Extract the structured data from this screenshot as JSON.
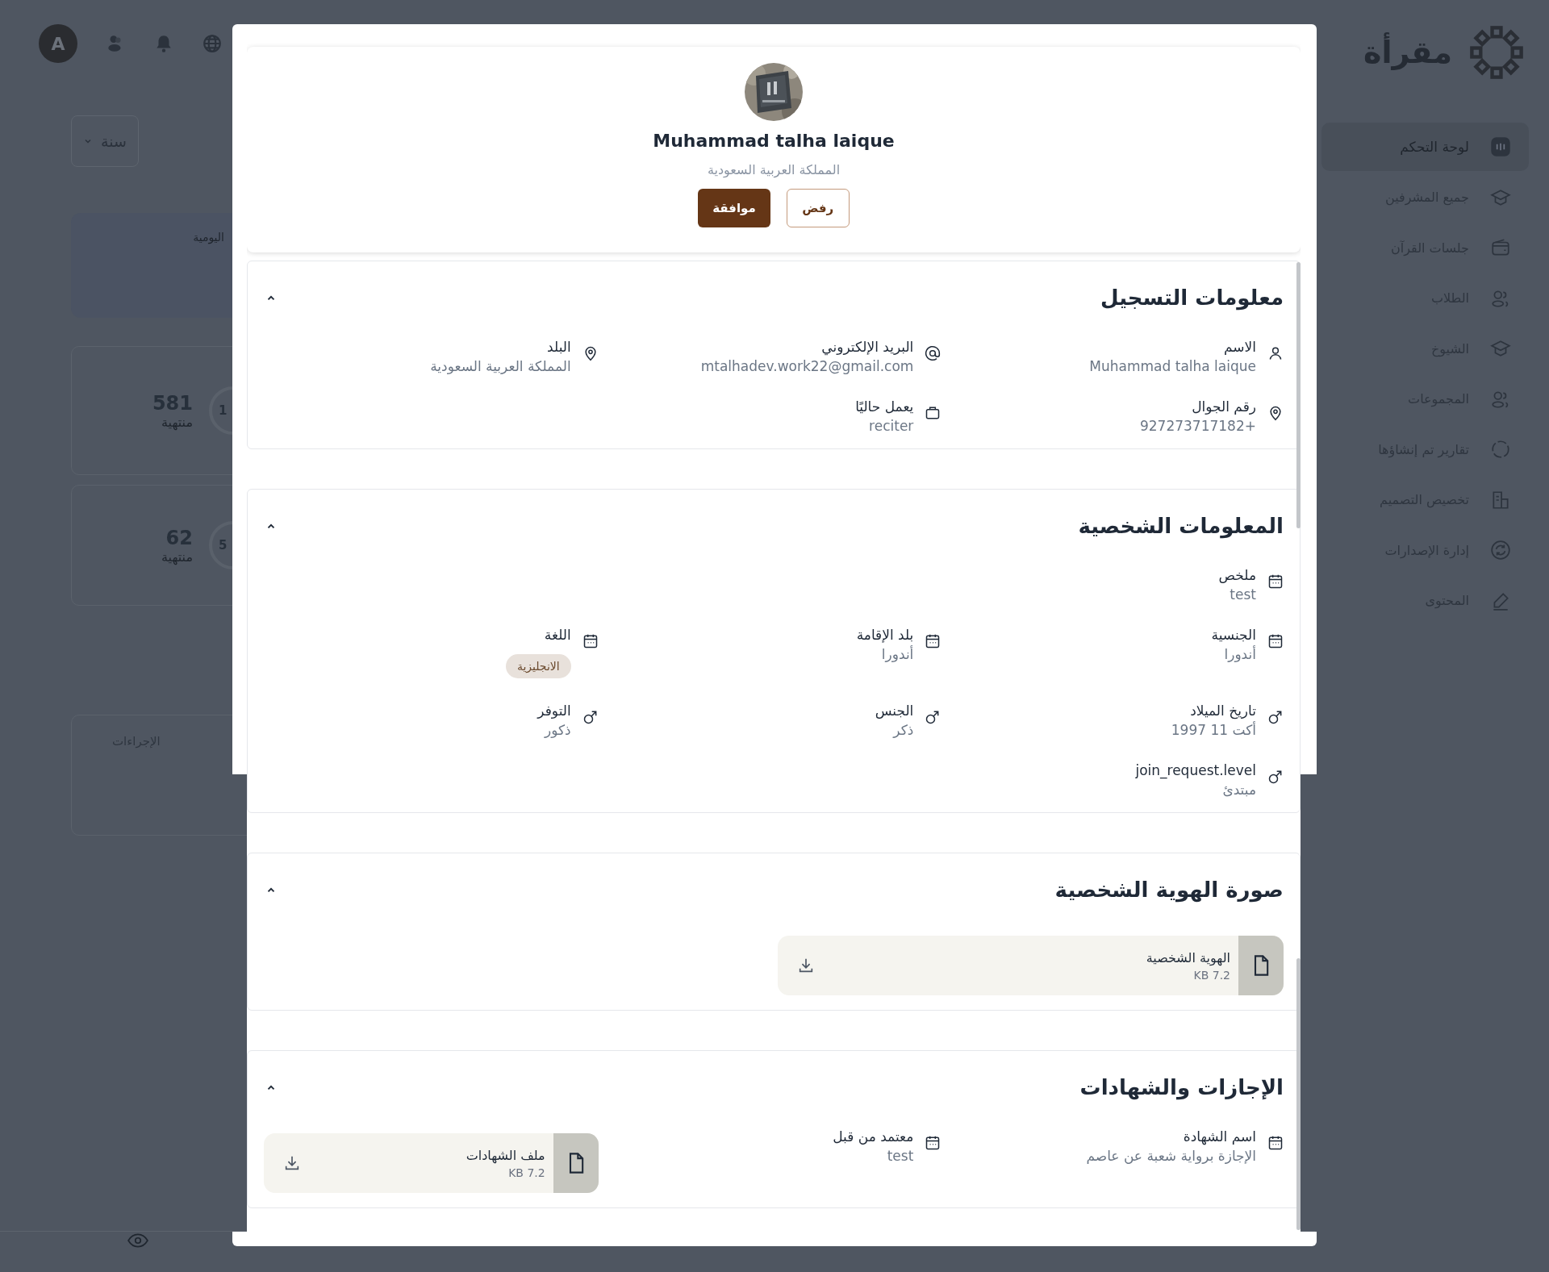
{
  "topbar": {
    "avatar_letter": "A"
  },
  "brand": {
    "name": "مقرأة"
  },
  "sidebar": {
    "items": [
      {
        "label": "لوحة التحكم",
        "selected": true
      },
      {
        "label": "جميع المشرفين",
        "selected": false
      },
      {
        "label": "جلسات القرآن",
        "selected": false
      },
      {
        "label": "الطلاب",
        "selected": false
      },
      {
        "label": "الشيوخ",
        "selected": false
      },
      {
        "label": "المجموعات",
        "selected": false
      },
      {
        "label": "تقارير تم إنشاؤها",
        "selected": false
      },
      {
        "label": "تخصيص التصميم",
        "selected": false
      },
      {
        "label": "إدارة الإصدارات",
        "selected": false
      },
      {
        "label": "المحتوى",
        "selected": false
      }
    ]
  },
  "dashboard": {
    "period_select": "سنة",
    "daily_card": {
      "title": "اليومية"
    },
    "stats": [
      {
        "value": "581",
        "label": "منتهية",
        "ring_text": "1"
      },
      {
        "value": "62",
        "label": "منتهية",
        "ring_text": "5"
      }
    ],
    "actions_card": {
      "title": "الإجراءات"
    }
  },
  "modal": {
    "profile": {
      "name": "Muhammad talha laique",
      "country": "المملكة العربية السعودية",
      "buttons": [
        {
          "label": "رفض",
          "kind": "outline"
        },
        {
          "label": "موافقة",
          "kind": "primary"
        }
      ]
    },
    "sections": [
      {
        "title": "معلومات التسجيل",
        "expanded": true,
        "rows": [
          [
            {
              "kind": "text",
              "label": "الاسم",
              "value": "Muhammad talha laique"
            },
            {
              "kind": "text",
              "label": "البريد الإلكتروني",
              "value": "mtalhadev.work22@gmail.com"
            },
            {
              "kind": "text",
              "label": "البلد",
              "value": "المملكة العربية السعودية"
            }
          ],
          [
            {
              "kind": "text",
              "label": "رقم الجوال",
              "value": "+927273717182"
            },
            {
              "kind": "text",
              "label": "يعمل حاليًا",
              "value": "reciter"
            }
          ]
        ]
      },
      {
        "title": "المعلومات الشخصية",
        "expanded": true,
        "rows": [
          [
            {
              "kind": "text",
              "label": "ملخص",
              "value": "test"
            }
          ],
          [
            {
              "kind": "text",
              "label": "الجنسية",
              "value": "أندورا"
            },
            {
              "kind": "text",
              "label": "بلد الإقامة",
              "value": "أندورا"
            },
            {
              "kind": "tag",
              "label": "اللغة",
              "tags": [
                "الانجليزية"
              ]
            }
          ],
          [
            {
              "kind": "text",
              "label": "تاريخ الميلاد",
              "value": "أكت 11 1997"
            },
            {
              "kind": "text",
              "label": "الجنس",
              "value": "ذكر"
            },
            {
              "kind": "text",
              "label": "التوفر",
              "value": "ذكور"
            }
          ],
          [
            {
              "kind": "text",
              "label": "join_request.level",
              "value": "مبتدئ"
            }
          ]
        ]
      },
      {
        "title": "صورة الهوية الشخصية",
        "expanded": true,
        "rows": [
          [
            {
              "kind": "file",
              "name": "الهوية الشخصية",
              "size": "7.2 KB"
            }
          ]
        ]
      },
      {
        "title": "الإجازات والشهادات",
        "expanded": true,
        "rows": [
          [
            {
              "kind": "text",
              "label": "اسم الشهادة",
              "value": "الإجازة برواية شعبة عن عاصم"
            },
            {
              "kind": "text",
              "label": "معتمد من قبل",
              "value": "test"
            },
            {
              "kind": "file",
              "name": "ملف الشهادات",
              "size": "7.2 KB"
            }
          ]
        ]
      }
    ]
  }
}
